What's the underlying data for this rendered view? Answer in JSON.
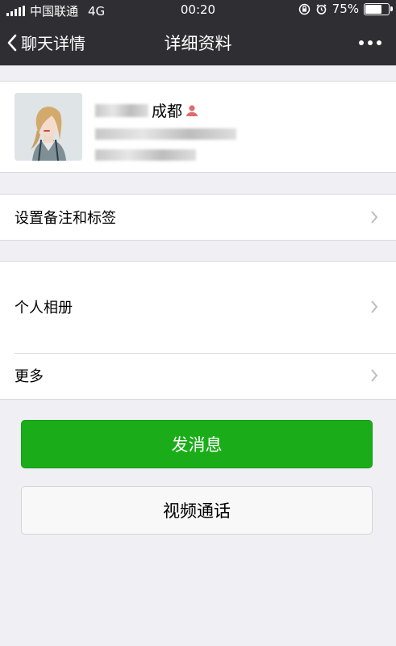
{
  "status_bar": {
    "carrier": "中国联通",
    "network": "4G",
    "time": "00:20",
    "battery": "75%",
    "battery_level": 0.75
  },
  "nav": {
    "back_label": "聊天详情",
    "title": "详细资料"
  },
  "profile": {
    "location": "成都",
    "gender_icon": "female-icon"
  },
  "menu": {
    "remark_label": "设置备注和标签",
    "album_label": "个人相册",
    "more_label": "更多"
  },
  "actions": {
    "send_message_label": "发消息",
    "video_call_label": "视频通话"
  },
  "colors": {
    "nav_bg": "#2e2e33",
    "accent_green": "#1aad19",
    "page_bg": "#efeff4"
  }
}
